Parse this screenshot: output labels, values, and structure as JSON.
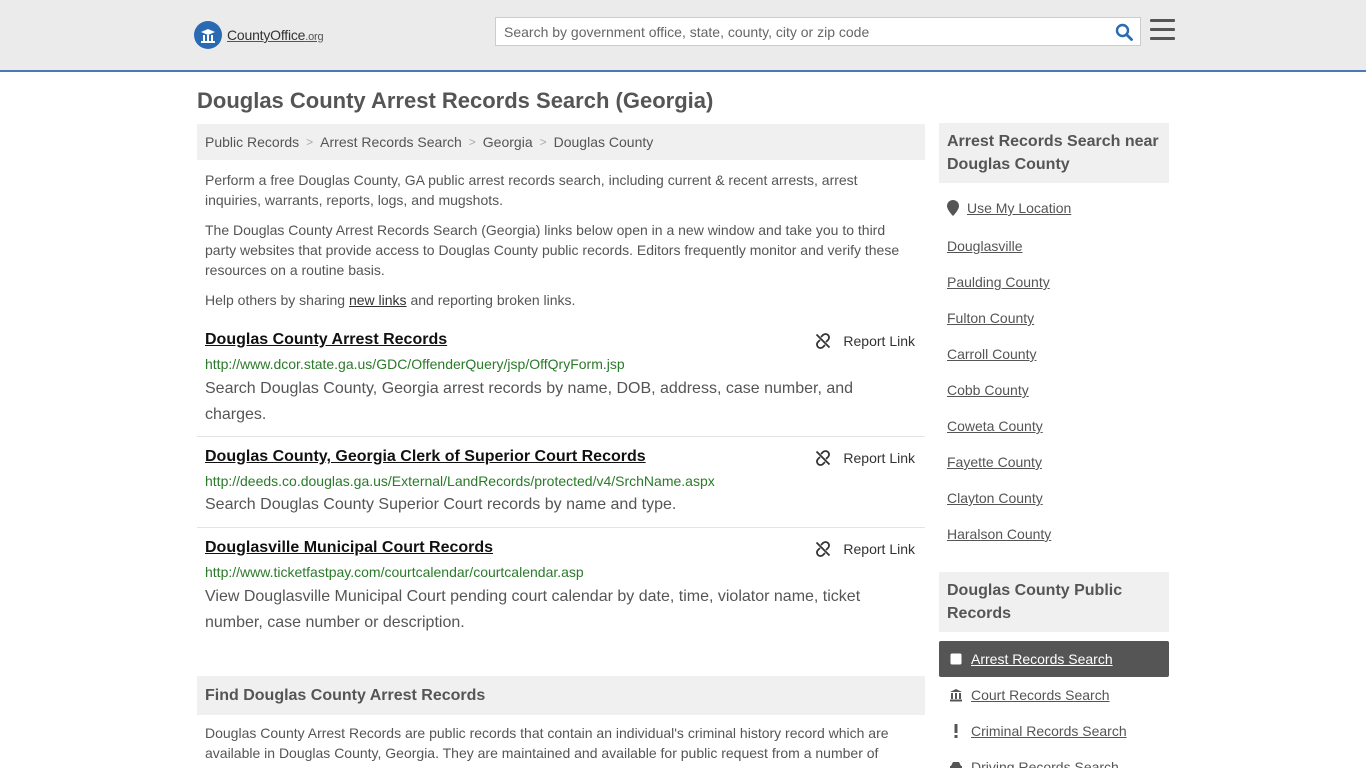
{
  "header": {
    "logo_brand": "CountyOffice",
    "logo_tld": ".org",
    "search_placeholder": "Search by government office, state, county, city or zip code"
  },
  "page": {
    "title": "Douglas County Arrest Records Search (Georgia)"
  },
  "breadcrumb": [
    "Public Records",
    "Arrest Records Search",
    "Georgia",
    "Douglas County"
  ],
  "intro": {
    "p1": "Perform a free Douglas County, GA public arrest records search, including current & recent arrests, arrest inquiries, warrants, reports, logs, and mugshots.",
    "p2": "The Douglas County Arrest Records Search (Georgia) links below open in a new window and take you to third party websites that provide access to Douglas County public records. Editors frequently monitor and verify these resources on a routine basis.",
    "p3_before": "Help others by sharing ",
    "p3_link": "new links",
    "p3_after": " and reporting broken links."
  },
  "report_label": "Report Link",
  "entries": [
    {
      "title": "Douglas County Arrest Records",
      "url": "http://www.dcor.state.ga.us/GDC/OffenderQuery/jsp/OffQryForm.jsp",
      "desc": "Search Douglas County, Georgia arrest records by name, DOB, address, case number, and charges."
    },
    {
      "title": "Douglas County, Georgia Clerk of Superior Court Records",
      "url": "http://deeds.co.douglas.ga.us/External/LandRecords/protected/v4/SrchName.aspx",
      "desc": "Search Douglas County Superior Court records by name and type."
    },
    {
      "title": "Douglasville Municipal Court Records",
      "url": "http://www.ticketfastpay.com/courtcalendar/courtcalendar.asp",
      "desc": "View Douglasville Municipal Court pending court calendar by date, time, violator name, ticket number, case number or description."
    }
  ],
  "find": {
    "heading": "Find Douglas County Arrest Records",
    "text": "Douglas County Arrest Records are public records that contain an individual's criminal history record which are available in Douglas County, Georgia. They are maintained and available for public request from a number of"
  },
  "sidebar": {
    "nearby_heading": "Arrest Records Search near Douglas County",
    "use_location": "Use My Location",
    "nearby": [
      "Douglasville",
      "Paulding County",
      "Fulton County",
      "Carroll County",
      "Cobb County",
      "Coweta County",
      "Fayette County",
      "Clayton County",
      "Haralson County"
    ],
    "public_heading": "Douglas County Public Records",
    "public_links": [
      {
        "label": "Arrest Records Search",
        "icon": "square-icon",
        "active": true
      },
      {
        "label": "Court Records Search",
        "icon": "courthouse-icon",
        "active": false
      },
      {
        "label": "Criminal Records Search",
        "icon": "exclamation-icon",
        "active": false
      },
      {
        "label": "Driving Records Search",
        "icon": "car-icon",
        "active": false
      }
    ]
  },
  "colors": {
    "brand_blue": "#2a6ab2",
    "url_green": "#2a7a2a",
    "active_bg": "#555555"
  }
}
